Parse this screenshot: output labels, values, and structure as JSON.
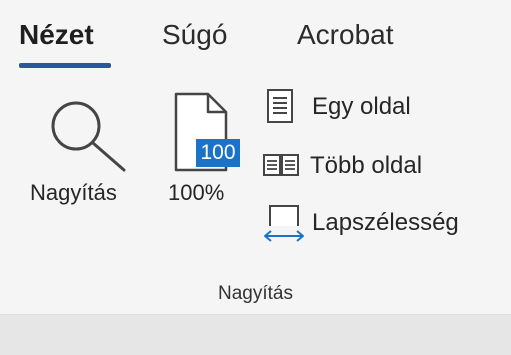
{
  "tabs": [
    {
      "label": "Nézet",
      "active": true
    },
    {
      "label": "Súgó",
      "active": false
    },
    {
      "label": "Acrobat",
      "active": false
    }
  ],
  "zoom_group": {
    "label": "Nagyítás",
    "zoom_button": {
      "label": "Nagyítás",
      "icon": "magnifier-icon"
    },
    "hundred_button": {
      "label": "100%",
      "icon_badge": "100",
      "icon": "page-100-icon"
    },
    "one_page": {
      "label": "Egy oldal",
      "icon": "one-page-icon"
    },
    "multiple_pages": {
      "label": "Több oldal",
      "icon": "multiple-pages-icon"
    },
    "page_width": {
      "label": "Lapszélesség",
      "icon": "page-width-icon"
    }
  },
  "colors": {
    "accent": "#2b579a",
    "icon_blue": "#1a73c9"
  }
}
